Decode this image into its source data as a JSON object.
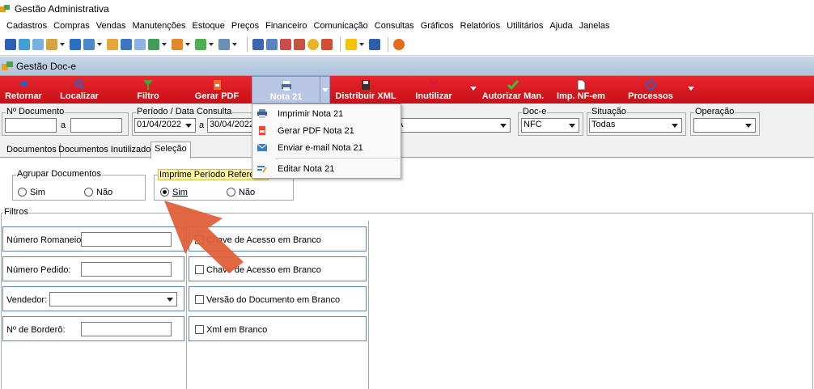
{
  "app": {
    "title": "Gestão Administrativa"
  },
  "menubar": [
    {
      "label": "Cadastros"
    },
    {
      "label": "Compras"
    },
    {
      "label": "Vendas"
    },
    {
      "label": "Manutenções"
    },
    {
      "label": "Estoque"
    },
    {
      "label": "Preços"
    },
    {
      "label": "Financeiro"
    },
    {
      "label": "Comunicação"
    },
    {
      "label": "Consultas"
    },
    {
      "label": "Gráficos"
    },
    {
      "label": "Relatórios"
    },
    {
      "label": "Utilitários"
    },
    {
      "label": "Ajuda"
    },
    {
      "label": "Janelas"
    }
  ],
  "window": {
    "title": "Gestão Doc-e"
  },
  "actions": {
    "retornar": "Retornar",
    "localizar": "Localizar",
    "filtro": "Filtro",
    "gerar_pdf": "Gerar PDF",
    "nota": "Nota 21",
    "distribuir_xml": "Distribuir XML",
    "inutilizar": "Inutilizar",
    "autorizar": "Autorizar Man.",
    "imp_nfem": "Imp. NF-em",
    "processos": "Processos"
  },
  "filters": {
    "num_doc_legend": "Nº Documento",
    "num_doc_to": "a",
    "num_doc_from_value": "",
    "num_doc_to_value": "",
    "periodo_legend": "Período / Data Consulta",
    "date_from": "01/04/2022",
    "date_sep": "a",
    "date_to": "30/04/2022",
    "hidden_combo_value": "A",
    "doce_legend": "Doc-e",
    "doce_value": "NFC",
    "situacao_legend": "Situação",
    "situacao_value": "Todas",
    "operacao_legend": "Operação",
    "operacao_value": ""
  },
  "dropdown_menu": {
    "imprimir": "Imprimir Nota 21",
    "gerar_pdf": "Gerar PDF Nota 21",
    "enviar_email": "Enviar e-mail Nota 21",
    "editar": "Editar Nota 21"
  },
  "tabs": [
    {
      "label": "Documentos"
    },
    {
      "label": "Documentos Inutilizados"
    },
    {
      "label": "Seleção"
    }
  ],
  "selecao": {
    "agrupar_legend": "Agrupar Documentos",
    "agrupar_sim": "Sim",
    "agrupar_nao": "Não",
    "imprime_legend": "Imprime Período Referente",
    "imprime_sim": "Sim",
    "imprime_nao": "Não",
    "filtros_legend": "Filtros",
    "numero_romaneio": "Número Romaneio:",
    "numero_pedido": "Número Pedido:",
    "vendedor": "Vendedor:",
    "num_bordero": "Nº de Borderô:",
    "chk1": "Chave de Acesso em Branco",
    "chk2": "Chave de Acesso em Branco",
    "chk3": "Versão do Documento em Branco",
    "chk4": "Xml em Branco"
  },
  "colors": {
    "action_bar": "#d9141c",
    "arrow": "#e0603a",
    "highlight": "#fff3a0"
  }
}
